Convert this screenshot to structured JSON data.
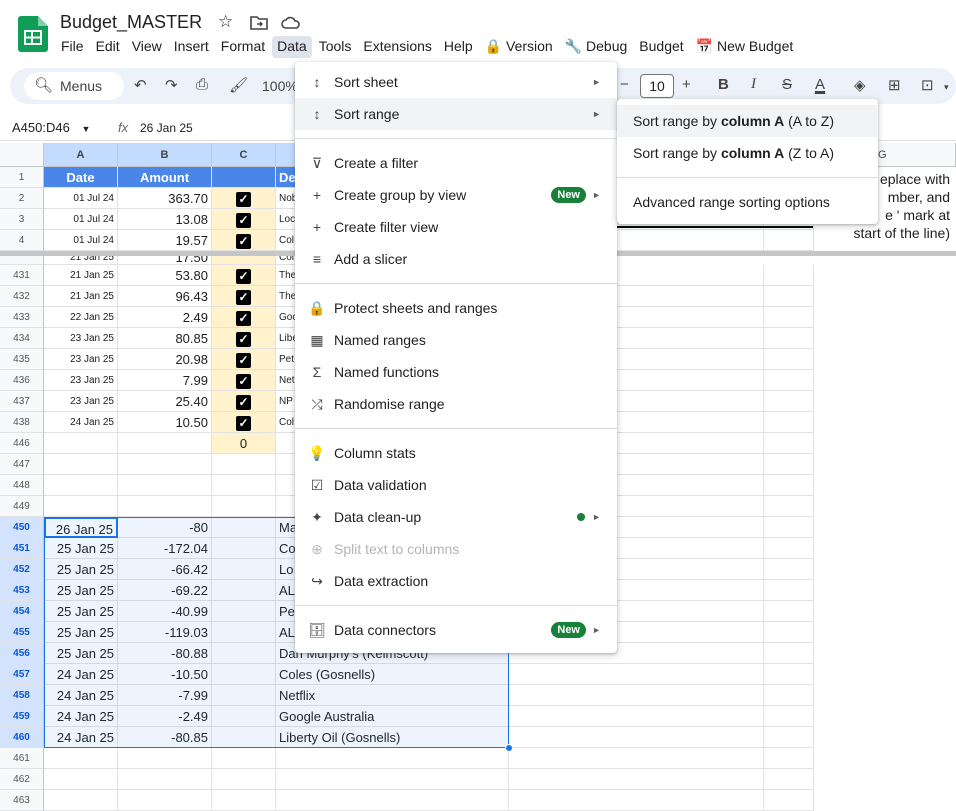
{
  "header": {
    "doc_title": "Budget_MASTER",
    "menus": [
      "File",
      "Edit",
      "View",
      "Insert",
      "Format",
      "Data",
      "Tools",
      "Extensions",
      "Help",
      "🔒 Version",
      "🔧 Debug",
      "Budget",
      "📅 New Budget"
    ]
  },
  "toolbar": {
    "menus_label": "Menus",
    "zoom": "100%",
    "font_size": "10"
  },
  "formula": {
    "name_box": "A450:D46",
    "fx": "fx",
    "value": "26 Jan 25"
  },
  "columns": {
    "a": "A",
    "b": "B",
    "c": "C",
    "g": "G"
  },
  "header_row": {
    "num": "1",
    "date": "Date",
    "amount": "Amount",
    "desc": "De"
  },
  "top_rows": [
    {
      "num": "2",
      "date": "01 Jul 24",
      "amount": "363.70",
      "desc": "Nob"
    },
    {
      "num": "3",
      "date": "01 Jul 24",
      "amount": "13.08",
      "desc": "Loc"
    },
    {
      "num": "4",
      "date": "01 Jul 24",
      "amount": "19.57",
      "desc": "Col"
    }
  ],
  "hidden_row_stub": {
    "date": "21 Jan 25",
    "amount": "17.50",
    "desc": "Col"
  },
  "mid_rows": [
    {
      "num": "431",
      "date": "21 Jan 25",
      "amount": "53.80",
      "desc": "The"
    },
    {
      "num": "432",
      "date": "21 Jan 25",
      "amount": "96.43",
      "desc": "The"
    },
    {
      "num": "433",
      "date": "22 Jan 25",
      "amount": "2.49",
      "desc": "Goo"
    },
    {
      "num": "434",
      "date": "23 Jan 25",
      "amount": "80.85",
      "desc": "Libe"
    },
    {
      "num": "435",
      "date": "23 Jan 25",
      "amount": "20.98",
      "desc": "Pet"
    },
    {
      "num": "436",
      "date": "23 Jan 25",
      "amount": "7.99",
      "desc": "Net"
    },
    {
      "num": "437",
      "date": "23 Jan 25",
      "amount": "25.40",
      "desc": "NP"
    },
    {
      "num": "438",
      "date": "24 Jan 25",
      "amount": "10.50",
      "desc": "Col"
    }
  ],
  "total_row": {
    "num": "446",
    "c": "0"
  },
  "empty_rows_a": [
    "447",
    "448",
    "449"
  ],
  "sel_rows": [
    {
      "num": "450",
      "date": "26 Jan 25",
      "amount": "-80",
      "desc": "Ma"
    },
    {
      "num": "451",
      "date": "25 Jan 25",
      "amount": "-172.04",
      "desc": "Co"
    },
    {
      "num": "452",
      "date": "25 Jan 25",
      "amount": "-66.42",
      "desc": "Lo"
    },
    {
      "num": "453",
      "date": "25 Jan 25",
      "amount": "-69.22",
      "desc": "AL"
    },
    {
      "num": "454",
      "date": "25 Jan 25",
      "amount": "-40.99",
      "desc": "Pe"
    },
    {
      "num": "455",
      "date": "25 Jan 25",
      "amount": "-119.03",
      "desc": "AL"
    },
    {
      "num": "456",
      "date": "25 Jan 25",
      "amount": "-80.88",
      "desc": "Dan Murphy's (Kelmscott)"
    },
    {
      "num": "457",
      "date": "24 Jan 25",
      "amount": "-10.50",
      "desc": "Coles (Gosnells)"
    },
    {
      "num": "458",
      "date": "24 Jan 25",
      "amount": "-7.99",
      "desc": "Netflix"
    },
    {
      "num": "459",
      "date": "24 Jan 25",
      "amount": "-2.49",
      "desc": "Google Australia"
    },
    {
      "num": "460",
      "date": "24 Jan 25",
      "amount": "-80.85",
      "desc": "Liberty Oil (Gosnells)"
    }
  ],
  "empty_rows_b": [
    "461",
    "462",
    "463"
  ],
  "note_lines": [
    "eplace with",
    "mber, and",
    "e ' mark at",
    "start of the line)"
  ],
  "data_menu": {
    "items": [
      {
        "label": "Sort sheet",
        "icon": "↕",
        "arrow": "►"
      },
      {
        "label": "Sort range",
        "icon": "↕",
        "arrow": "►"
      },
      {
        "label": "Create a filter",
        "icon": "⊽"
      },
      {
        "label": "Create group by view",
        "icon": "+",
        "badge": "New",
        "arrow": "►"
      },
      {
        "label": "Create filter view",
        "icon": "+"
      },
      {
        "label": "Add a slicer",
        "icon": "≡"
      },
      {
        "label": "Protect sheets and ranges",
        "icon": "🔒"
      },
      {
        "label": "Named ranges",
        "icon": "▦"
      },
      {
        "label": "Named functions",
        "icon": "Σ"
      },
      {
        "label": "Randomise range",
        "icon": "⤮"
      },
      {
        "label": "Column stats",
        "icon": "💡"
      },
      {
        "label": "Data validation",
        "icon": "☑"
      },
      {
        "label": "Data clean-up",
        "icon": "✦",
        "arrow": "►"
      },
      {
        "label": "Split text to columns",
        "icon": "⊕"
      },
      {
        "label": "Data extraction",
        "icon": "↪"
      },
      {
        "label": "Data connectors",
        "icon": "🗄",
        "badge": "New",
        "arrow": "►"
      }
    ]
  },
  "sort_submenu": {
    "a_to_z_prefix": "Sort range by ",
    "a_to_z_bold": "column A",
    "a_to_z_suffix": " (A to Z)",
    "z_to_a_prefix": "Sort range by ",
    "z_to_a_bold": "column A",
    "z_to_a_suffix": " (Z to A)",
    "advanced": "Advanced range sorting options"
  },
  "colors": {
    "selection": "#1a73e8",
    "badge": "#188038",
    "checkbox_fill": "#fff2cc"
  }
}
